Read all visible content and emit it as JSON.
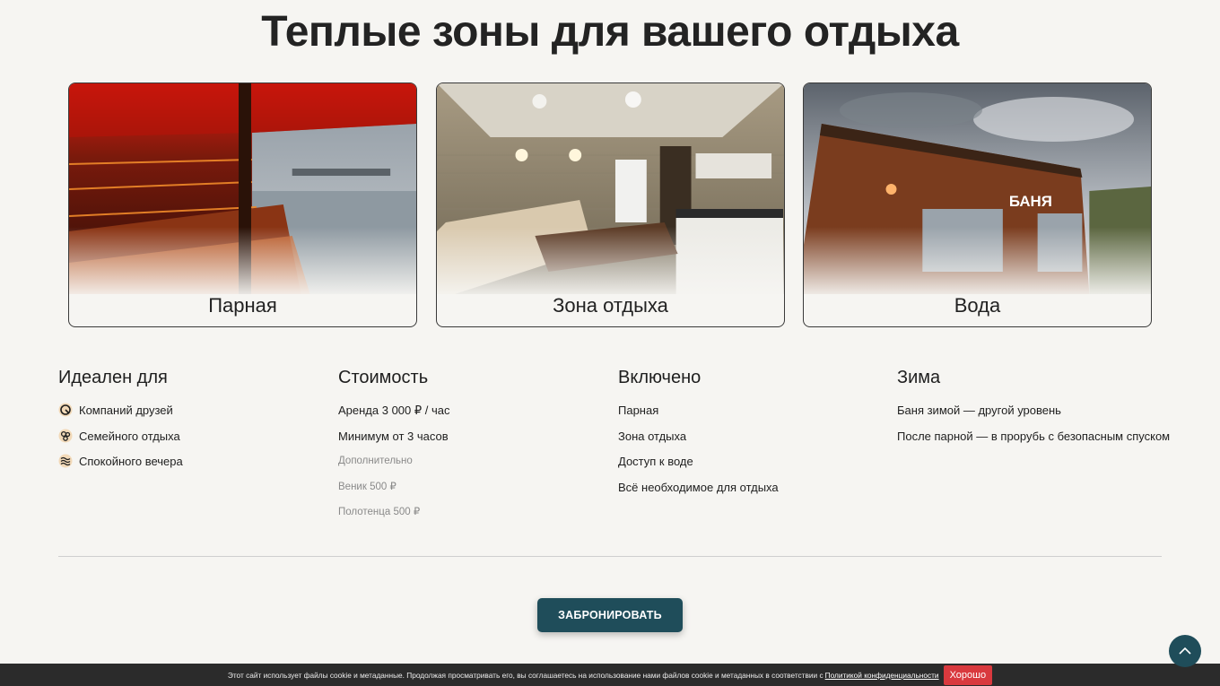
{
  "title": "Теплые зоны для вашего отдыха",
  "cards": [
    {
      "label": "Парная",
      "image": "sauna-photo"
    },
    {
      "label": "Зона отдыха",
      "image": "lounge-photo"
    },
    {
      "label": "Вода",
      "image": "water-photo"
    }
  ],
  "columns": {
    "ideal": {
      "heading": "Идеален для",
      "items": [
        {
          "text": "Компаний друзей",
          "icon": "friends-icon"
        },
        {
          "text": "Семейного отдыха",
          "icon": "family-icon"
        },
        {
          "text": "Спокойного вечера",
          "icon": "calm-icon"
        }
      ]
    },
    "price": {
      "heading": "Стоимость",
      "items": [
        "Аренда 3 000 ₽ / час",
        "Минимум от 3 часов"
      ],
      "extra_heading": "Дополнительно",
      "extras": [
        "Веник 500 ₽",
        "Полотенца 500 ₽"
      ]
    },
    "included": {
      "heading": "Включено",
      "items": [
        "Парная",
        "Зона отдыха",
        "Доступ к воде",
        "Всё необходимое для отдыха"
      ]
    },
    "winter": {
      "heading": "Зима",
      "items": [
        "Баня зимой — другой уровень",
        "После парной — в прорубь с безопасным спуском"
      ]
    }
  },
  "book_button": "ЗАБРОНИРОВАТЬ",
  "cookie": {
    "text": "Этот сайт использует файлы cookie и метаданные. Продолжая просматривать его, вы соглашаетесь на использование нами файлов cookie и метаданных в соответствии с",
    "link": "Политикой конфиденциальности",
    "ok": "Хорошо"
  },
  "colors": {
    "accent": "#1f4d5a",
    "cookie_ok": "#d9393e",
    "background": "#f6f5f2"
  }
}
